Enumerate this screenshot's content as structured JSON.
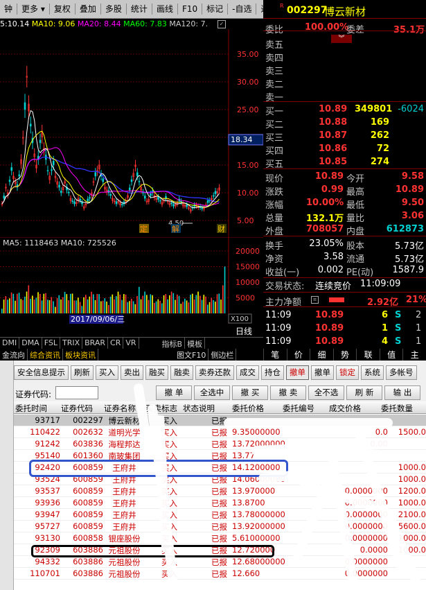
{
  "toolbar": {
    "items": [
      "钟",
      "更多",
      "复权",
      "叠加",
      "多股",
      "统计",
      "画线",
      "F10",
      "标记",
      "-自选",
      "返回"
    ]
  },
  "ma_line": {
    "ma5": "5:10.14",
    "ma10": "MA10: 9.06",
    "ma20": "MA20: 8.44",
    "ma60": "MA60: 7.83",
    "ma120": "MA120: 7."
  },
  "kchart": {
    "price_ticks": [
      "35.00",
      "30.00",
      "25.00",
      "20.00",
      "15.00",
      "10.00",
      "5.00"
    ],
    "highlight_price": "18.34",
    "markers": [
      "定",
      "解",
      "财"
    ],
    "low_label": "4.50"
  },
  "volchart": {
    "ma_text": "MA5: 1118463  MA10: 725526",
    "ticks": [
      "20000",
      "15000",
      "10000",
      "5000"
    ],
    "unit": "X100",
    "date": "2017/09/06/三"
  },
  "bottom_tabs": {
    "row1": [
      "DMI",
      "DMA",
      "FSL",
      "TRIX",
      "BRAR",
      "CR",
      "VR"
    ],
    "row1b": [
      "指标B",
      "模板"
    ],
    "row2": [
      "金流向",
      "综合资讯",
      "板块资讯"
    ],
    "row2b": [
      "图文F10",
      "侧边栏"
    ]
  },
  "right_tabs": [
    "笔",
    "价",
    "细",
    "势",
    "联",
    "值",
    "主"
  ],
  "day_line": "日线",
  "quote": {
    "flag": "R",
    "code": "002297",
    "name": "博云新材",
    "weibi_label": "委比",
    "weibi": "100.00%",
    "weicha_label": "委差",
    "weicha": "35.1万",
    "asks": [
      {
        "label": "卖五"
      },
      {
        "label": "卖四"
      },
      {
        "label": "卖三"
      },
      {
        "label": "卖二"
      },
      {
        "label": "卖一"
      }
    ],
    "bids": [
      {
        "label": "买一",
        "price": "10.89",
        "vol": "349801",
        "chg": "-6024"
      },
      {
        "label": "买二",
        "price": "10.88",
        "vol": "169",
        "chg": ""
      },
      {
        "label": "买三",
        "price": "10.87",
        "vol": "262",
        "chg": ""
      },
      {
        "label": "买四",
        "price": "10.86",
        "vol": "72",
        "chg": ""
      },
      {
        "label": "买五",
        "price": "10.85",
        "vol": "274",
        "chg": ""
      }
    ],
    "stats": [
      {
        "l1": "现价",
        "v1": "10.89",
        "l2": "今开",
        "v2": "9.58"
      },
      {
        "l1": "涨跌",
        "v1": "0.99",
        "l2": "最高",
        "v2": "10.89"
      },
      {
        "l1": "涨幅",
        "v1": "10.00%",
        "l2": "最低",
        "v2": "9.50"
      },
      {
        "l1": "总量",
        "v1": "132.1万",
        "l2": "量比",
        "v2": "3.06"
      },
      {
        "l1": "外盘",
        "v1": "708057",
        "l2": "内盘",
        "v2": "612873"
      }
    ],
    "stats2": [
      {
        "l1": "换手",
        "v1": "23.05%",
        "l2": "股本",
        "v2": "5.73亿"
      },
      {
        "l1": "净资",
        "v1": "3.58",
        "l2": "流通",
        "v2": "5.73亿"
      },
      {
        "l1": "收益(一)",
        "v1": "0.002",
        "l2": "PE(动)",
        "v2": "1587.9"
      }
    ],
    "trade_status_label": "交易状态:",
    "trade_status": "连续竞价",
    "trade_time": "11:09:09",
    "main_flow_label": "主力净额",
    "main_flow": "2.92亿",
    "main_flow_pct": "21%",
    "ticks": [
      {
        "time": "11:09",
        "price": "10.89",
        "vol": "6",
        "side": "S",
        "n": "2"
      },
      {
        "time": "11:09",
        "price": "10.89",
        "vol": "1",
        "side": "S",
        "n": "1"
      },
      {
        "time": "11:09",
        "price": "10.89",
        "vol": "4",
        "side": "S",
        "n": "1"
      }
    ]
  },
  "buttons": [
    "安全信息提示",
    "刷新",
    "买入",
    "卖出",
    "融买",
    "融卖",
    "卖券还款",
    "成交",
    "持仓",
    "撤单",
    "撤单",
    "锁定",
    "系统",
    "多帐号"
  ],
  "code_bar": {
    "label": "证券代码:",
    "value": "",
    "buttons": [
      "撤 单",
      "全选中",
      "撤 买",
      "撤 卖",
      "全不选",
      "刷 新",
      "输 出"
    ]
  },
  "grid": {
    "headers": [
      "委托时间",
      "证券代码",
      "证券名称",
      "买卖标志",
      "状态说明",
      "委托价格",
      "委托编号",
      "成交价格",
      "委托数量"
    ],
    "rows": [
      {
        "time": "93717",
        "code": "002297",
        "name": "博云新材",
        "flag": "买入",
        "status": "已报",
        "price": "",
        "deal": "",
        "qty": ""
      },
      {
        "time": "110422",
        "code": "002632",
        "name": "道明光学",
        "flag": "买入",
        "status": "已报",
        "price": "9.35000000",
        "deal": "0.0",
        "qty": "1500.0"
      },
      {
        "time": "91242",
        "code": "603836",
        "name": "海程邦达",
        "flag": "买入",
        "status": "已报",
        "price": "13.72000000",
        "deal": "0.00",
        "qty": ""
      },
      {
        "time": "95140",
        "code": "601360",
        "name": "南玻集团",
        "flag": "买入",
        "status": "已报",
        "price": "13.77",
        "deal": "",
        "qty": ""
      },
      {
        "time": "92420",
        "code": "600859",
        "name": "王府井",
        "flag": "买入",
        "status": "已报",
        "price": "14.1200000",
        "deal": "",
        "qty": "1000.0"
      },
      {
        "time": "93524",
        "code": "600859",
        "name": "王府井",
        "flag": "买入",
        "status": "已报",
        "price": "14.06000000",
        "deal": "",
        "qty": "1000.0"
      },
      {
        "time": "93537",
        "code": "600859",
        "name": "王府井",
        "flag": "买入",
        "status": "已报",
        "price": "13.970000",
        "deal": "0.0000000",
        "qty": "1200.0"
      },
      {
        "time": "93936",
        "code": "600859",
        "name": "王府井",
        "flag": "买入",
        "status": "已报",
        "price": "13.8700",
        "deal": "0.0000000",
        "qty": "1000.0"
      },
      {
        "time": "93947",
        "code": "600859",
        "name": "王府井",
        "flag": "买入",
        "status": "已报",
        "price": "13.78000000",
        "deal": "0.0000000",
        "qty": "2100.0"
      },
      {
        "time": "95727",
        "code": "600859",
        "name": "王府井",
        "flag": "买入",
        "status": "已报",
        "price": "13.92000000",
        "deal": "0.0000000",
        "qty": "5600.0"
      },
      {
        "time": "93130",
        "code": "600858",
        "name": "银座股份",
        "flag": "买入",
        "status": "已报",
        "price": "5.61000000",
        "deal": "0.0000000",
        "qty": "1000.0"
      },
      {
        "time": "92309",
        "code": "603886",
        "name": "元祖股份",
        "flag": "买入",
        "status": "已报",
        "price": "12.720000",
        "deal": "0.0000",
        "qty": "1000.0"
      },
      {
        "time": "94332",
        "code": "603886",
        "name": "元祖股份",
        "flag": "买入",
        "status": "已报",
        "price": "12.68000000",
        "deal": "0.0000000",
        "qty": ""
      },
      {
        "time": "110701",
        "code": "603886",
        "name": "元祖股份",
        "flag": "买入",
        "status": "已报",
        "price": "12.660",
        "deal": "0.0000000",
        "qty": ""
      }
    ]
  },
  "colors": {
    "up": "#ff3232",
    "down": "#00d0d0",
    "yellow": "#ffff00",
    "blue_box": "#3355cc",
    "black_box": "#000000"
  }
}
